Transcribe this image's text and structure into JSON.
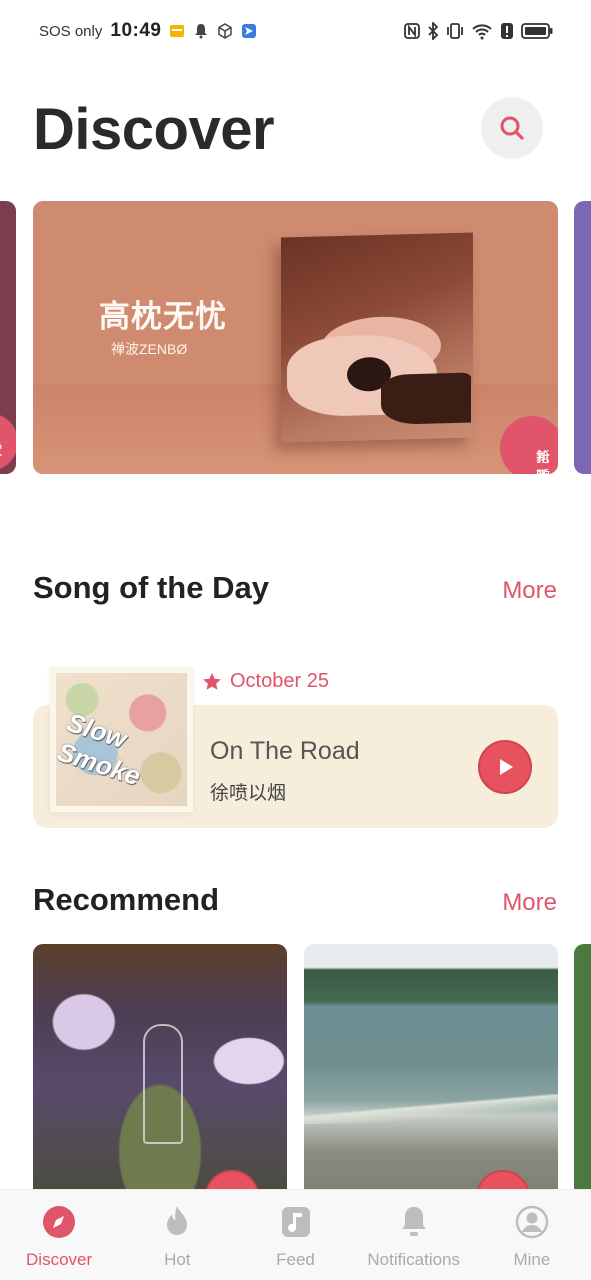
{
  "status_bar": {
    "carrier": "SOS only",
    "time": "10:49"
  },
  "header": {
    "title": "Discover"
  },
  "banner": {
    "title": "高枕无忧",
    "artist": "禅波ZENBØ",
    "tag_line1": "新歌",
    "tag_line2": "抢听",
    "left_tag_line1": "歌",
    "left_tag_line2": "听"
  },
  "song_of_the_day": {
    "heading": "Song of the Day",
    "more": "More",
    "date": "October 25",
    "song": "On The Road",
    "artist": "徐喷以烟",
    "cover_text": "Slow Smoke"
  },
  "recommend": {
    "heading": "Recommend",
    "more": "More"
  },
  "bottom_nav": {
    "items": [
      {
        "label": "Discover",
        "icon": "compass-icon",
        "active": true
      },
      {
        "label": "Hot",
        "icon": "flame-icon",
        "active": false
      },
      {
        "label": "Feed",
        "icon": "music-note-icon",
        "active": false
      },
      {
        "label": "Notifications",
        "icon": "bell-icon",
        "active": false
      },
      {
        "label": "Mine",
        "icon": "user-icon",
        "active": false
      }
    ]
  },
  "colors": {
    "accent": "#e0556a",
    "banner_bg": "#cf8b6f",
    "sotd_card": "#f6eddb"
  }
}
